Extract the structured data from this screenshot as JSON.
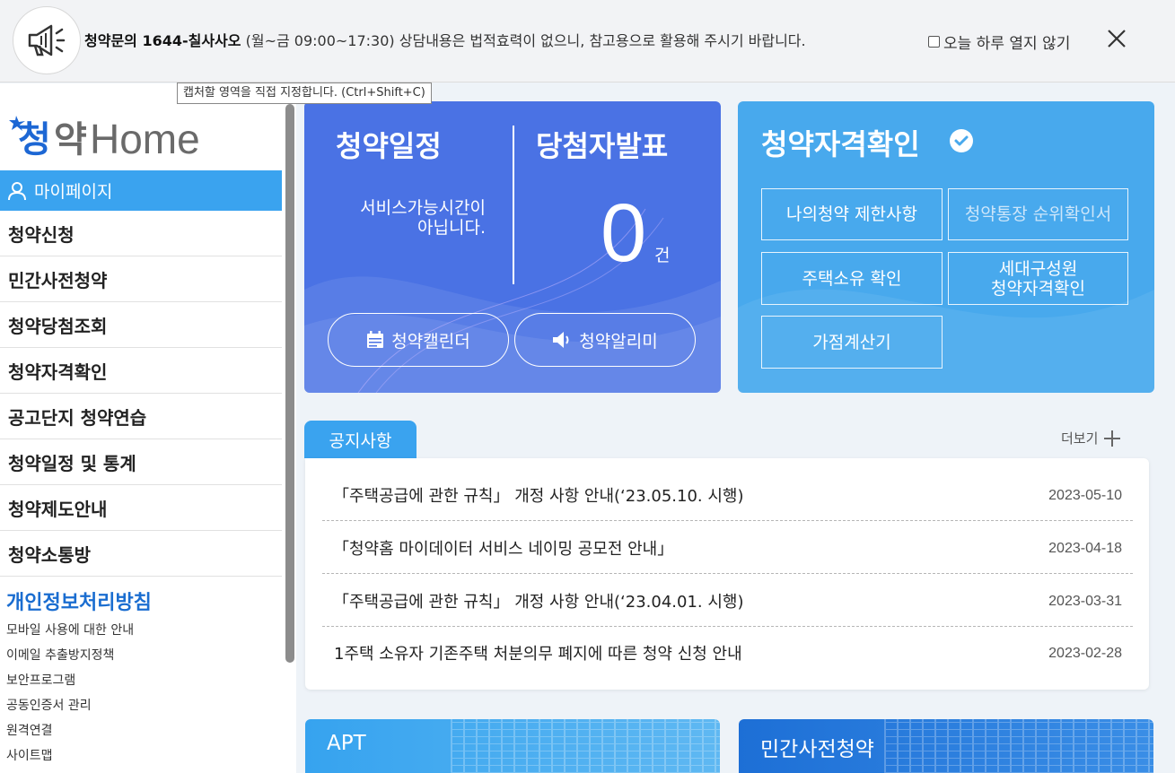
{
  "banner": {
    "phone_label": "청약문의 1644-칠사사오",
    "hours": "(월~금 09:00~17:30)",
    "disclaimer": "상담내용은 법적효력이 없으니, 참고용으로 활용해 주시기 바랍니다.",
    "dismiss_label": "오늘 하루 열지 않기"
  },
  "tooltip": "캡처할 영역을 직접 지정합니다. (Ctrl+Shift+C)",
  "sidebar": {
    "logo_text": "청약Home",
    "mypage": "마이페이지",
    "menu": [
      "청약신청",
      "민간사전청약",
      "청약당첨조회",
      "청약자격확인",
      "공고단지 청약연습",
      "청약일정 및 통계",
      "청약제도안내",
      "청약소통방"
    ],
    "privacy": "개인정보처리방침",
    "links": [
      "모바일 사용에 대한 안내",
      "이메일 추출방지정책",
      "보안프로그램",
      "공동인증서 관리",
      "원격연결",
      "사이트맵"
    ]
  },
  "schedule_card": {
    "title": "청약일정",
    "service_msg_1": "서비스가능시간이",
    "service_msg_2": "아닙니다.",
    "winner_title": "당첨자발표",
    "winner_count": "0",
    "winner_unit": "건",
    "calendar_btn": "청약캘린더",
    "alarm_btn": "청약알리미"
  },
  "qualification_card": {
    "title": "청약자격확인",
    "buttons": [
      "나의청약 제한사항",
      "청약통장 순위확인서",
      "주택소유 확인",
      "세대구성원",
      "청약자격확인",
      "가점계산기"
    ]
  },
  "notices": {
    "tab": "공지사항",
    "more": "더보기",
    "items": [
      {
        "title": "「주택공급에 관한 규칙」 개정 사항 안내(‘23.05.10. 시행)",
        "date": "2023-05-10"
      },
      {
        "title": "「청약홈 마이데이터 서비스 네이밍 공모전 안내」",
        "date": "2023-04-18"
      },
      {
        "title": "「주택공급에 관한 규칙」 개정 사항 안내(‘23.04.01. 시행)",
        "date": "2023-03-31"
      },
      {
        "title": "1주택 소유자 기존주택 처분의무 폐지에 따른 청약 신청 안내",
        "date": "2023-02-28"
      }
    ]
  },
  "bottom_cards": {
    "apt": "APT",
    "pre_sale": "민간사전청약"
  },
  "colors": {
    "primary_blue": "#4a72e4",
    "sky_blue": "#48a9ed",
    "accent": "#3aa3ef",
    "privacy_link": "#1a6dd0"
  }
}
